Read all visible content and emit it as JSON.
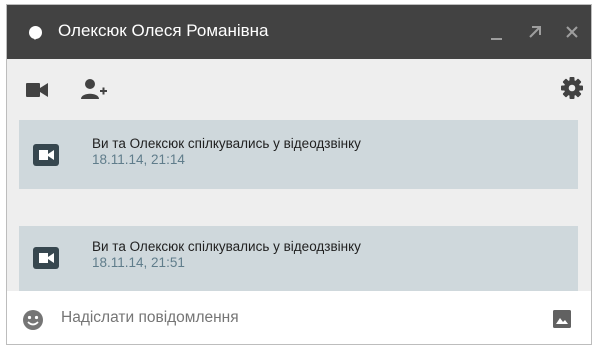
{
  "titlebar": {
    "contact_name": "Олексюк Олеся Романівна",
    "minimize_label": "_",
    "colors": {
      "background": "#424242",
      "text": "#ffffff",
      "controls": "#9e9e9e"
    },
    "icons": [
      "presence-icon",
      "minimize-icon",
      "popout-icon",
      "close-icon"
    ]
  },
  "toolbar": {
    "icons": [
      "video-call-icon",
      "add-person-icon",
      "settings-icon"
    ],
    "colors": {
      "background": "#eeeeee",
      "icon": "#424242"
    }
  },
  "messages": [
    {
      "icon": "video-call-icon",
      "text": "Ви та Олексюк спілкувались у відеодзвінку",
      "time": "18.11.14, 21:14"
    },
    {
      "icon": "video-call-icon",
      "text": "Ви та Олексюк спілкувались у відеодзвінку",
      "time": "18.11.14, 21:51"
    }
  ],
  "message_colors": {
    "bubble": "#cfd8dc",
    "text": "#212121",
    "time": "#607d8b"
  },
  "composer": {
    "placeholder": "Надіслати повідомлення",
    "value": "",
    "icons": [
      "emoji-icon",
      "insert-image-icon"
    ]
  }
}
